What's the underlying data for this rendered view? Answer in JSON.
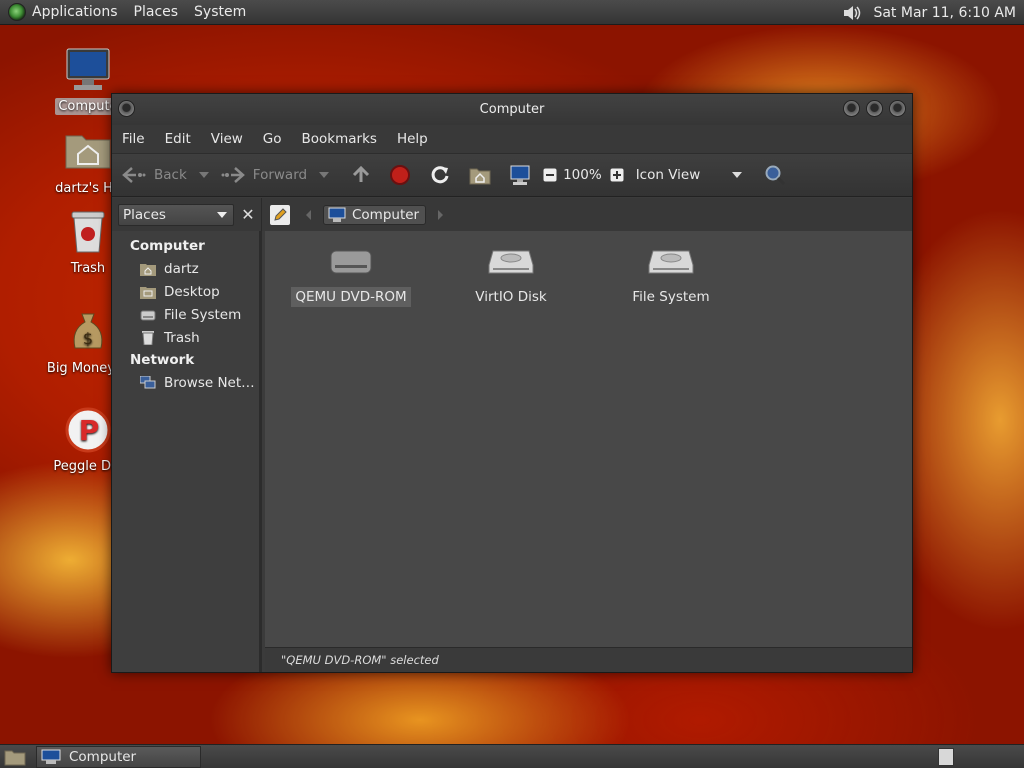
{
  "top_panel": {
    "menus": [
      "Applications",
      "Places",
      "System"
    ],
    "clock": "Sat Mar 11,  6:10 AM"
  },
  "desktop_icons": [
    {
      "label": "Compute",
      "icon": "computer-icon"
    },
    {
      "label": "dartz's Ho",
      "icon": "home-folder-icon"
    },
    {
      "label": "Trash",
      "icon": "trash-icon"
    },
    {
      "label": "Big Money D",
      "icon": "money-bag-icon"
    },
    {
      "label": "Peggle Del",
      "icon": "peggle-icon"
    }
  ],
  "window": {
    "title": "Computer",
    "menubar": [
      "File",
      "Edit",
      "View",
      "Go",
      "Bookmarks",
      "Help"
    ],
    "toolbar": {
      "back_label": "Back",
      "forward_label": "Forward",
      "zoom_label": "100%",
      "view_mode": "Icon View"
    },
    "sidebar_select": "Places",
    "breadcrumb": "Computer",
    "sidebar": {
      "sections": [
        {
          "title": "Computer",
          "items": [
            {
              "label": "dartz",
              "icon": "home-folder-icon"
            },
            {
              "label": "Desktop",
              "icon": "desktop-folder-icon"
            },
            {
              "label": "File System",
              "icon": "drive-icon"
            },
            {
              "label": "Trash",
              "icon": "trash-icon"
            }
          ]
        },
        {
          "title": "Network",
          "items": [
            {
              "label": "Browse Net…",
              "icon": "network-icon"
            }
          ]
        }
      ]
    },
    "files": [
      {
        "label": "QEMU DVD-ROM",
        "icon": "optical-drive-icon",
        "selected": true
      },
      {
        "label": "VirtIO Disk",
        "icon": "hard-disk-icon",
        "selected": false
      },
      {
        "label": "File System",
        "icon": "hard-disk-icon",
        "selected": false
      }
    ],
    "status": "\"QEMU DVD-ROM\" selected"
  },
  "taskbar": {
    "tasks": [
      {
        "label": "Computer"
      }
    ]
  },
  "colors": {
    "window_bg": "#3b3b3b",
    "content_bg": "#484848",
    "panel_bg": "#3a3a3a",
    "stop_red": "#c0201a"
  }
}
